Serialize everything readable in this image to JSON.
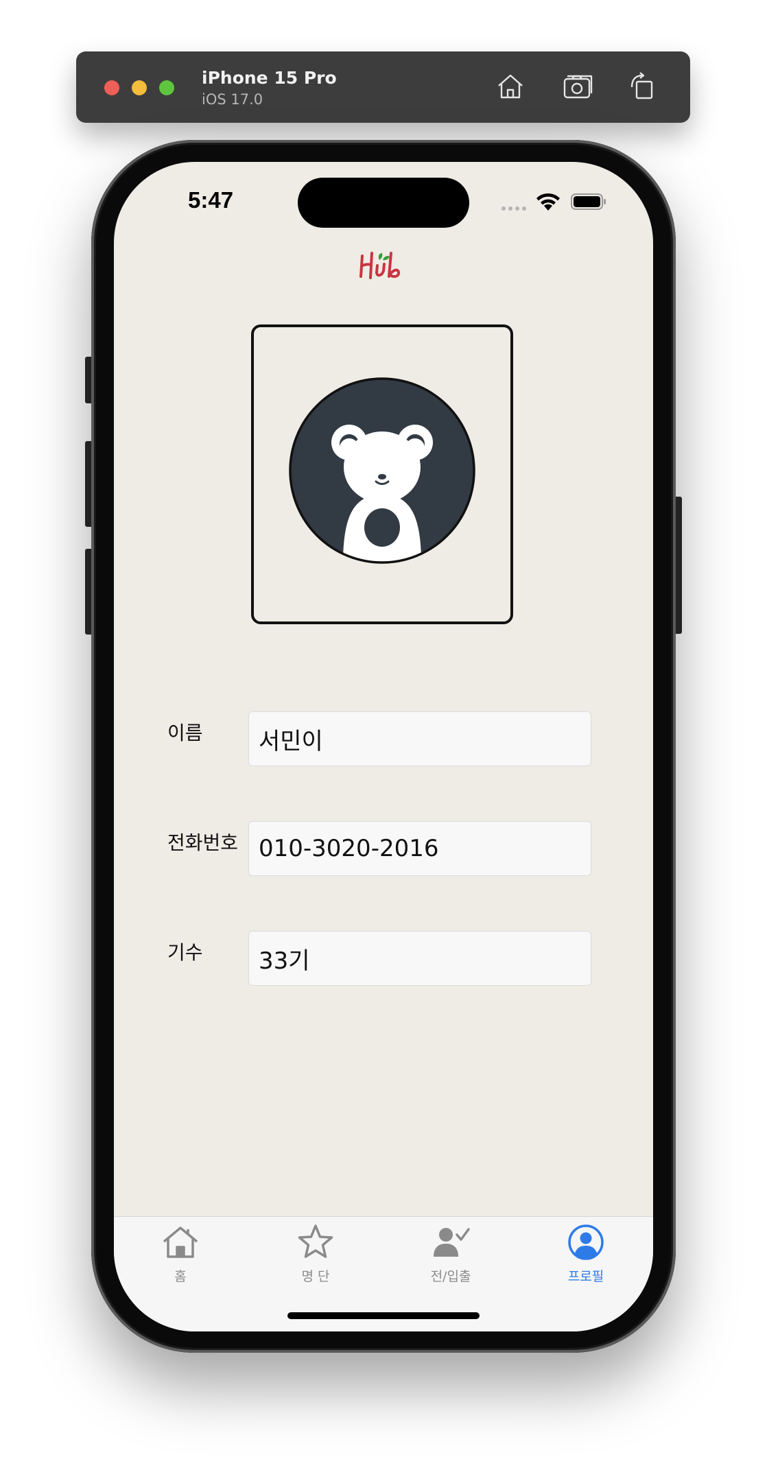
{
  "simulator": {
    "device_name": "iPhone 15 Pro",
    "os_version": "iOS 17.0",
    "buttons": [
      "home-icon",
      "screenshot-icon",
      "rotate-icon"
    ]
  },
  "status_bar": {
    "time": "5:47"
  },
  "app": {
    "logo_text": "Hub",
    "logo_color": "#c9353f"
  },
  "profile": {
    "fields": [
      {
        "label": "이름",
        "value": "서민이"
      },
      {
        "label": "전화번호",
        "value": "010-3020-2016"
      },
      {
        "label": "기수",
        "value": "33기"
      }
    ]
  },
  "tabbar": {
    "tabs": [
      {
        "label": "홈",
        "icon": "house-icon",
        "active": false
      },
      {
        "label": "명 단",
        "icon": "star-icon",
        "active": false
      },
      {
        "label": "전/입출",
        "icon": "person-check-icon",
        "active": false
      },
      {
        "label": "프로필",
        "icon": "person-circle-icon",
        "active": true
      }
    ],
    "active_color": "#2e7be8",
    "inactive_color": "#8a8a8a"
  }
}
